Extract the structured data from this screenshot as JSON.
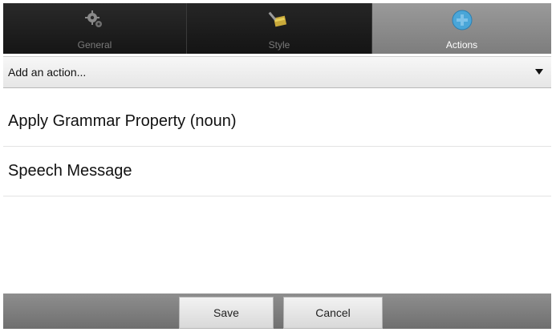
{
  "tabs": [
    {
      "label": "General",
      "icon": "gears-icon"
    },
    {
      "label": "Style",
      "icon": "paint-brush-icon"
    },
    {
      "label": "Actions",
      "icon": "add-action-icon"
    }
  ],
  "selected_tab": "Actions",
  "action_dropdown": {
    "placeholder": "Add an action..."
  },
  "actions": [
    {
      "label": "Apply Grammar Property (noun)"
    },
    {
      "label": "Speech Message"
    }
  ],
  "buttons": {
    "save_label": "Save",
    "cancel_label": "Cancel"
  },
  "colors": {
    "tab_bar": "#1a1a1a",
    "selected_tab": "#8a8a8a",
    "accent_icon": "#4aa6d8",
    "bottom_bar": "#7f7f7f"
  }
}
